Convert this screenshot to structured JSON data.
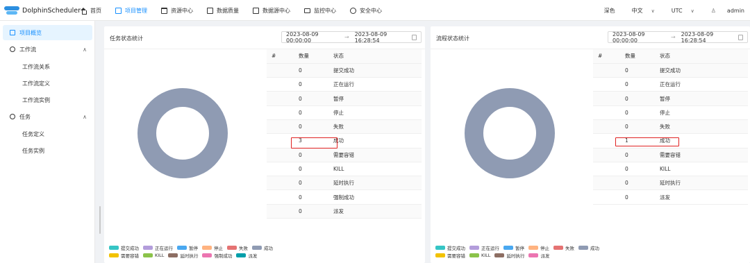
{
  "app": {
    "name": "DolphinScheduler"
  },
  "nav": [
    {
      "label": "首页",
      "icon": "home-icon"
    },
    {
      "label": "项目管理",
      "icon": "project-icon",
      "active": true
    },
    {
      "label": "资源中心",
      "icon": "folder-icon"
    },
    {
      "label": "数据质量",
      "icon": "quality-icon"
    },
    {
      "label": "数据源中心",
      "icon": "datasource-icon"
    },
    {
      "label": "监控中心",
      "icon": "monitor-icon"
    },
    {
      "label": "安全中心",
      "icon": "security-icon"
    }
  ],
  "header_right": {
    "theme": "深色",
    "language": "中文",
    "timezone": "UTC",
    "user": "admin"
  },
  "sidebar": {
    "overview": "项目概览",
    "workflow": "工作流",
    "workflow_items": [
      "工作流关系",
      "工作流定义",
      "工作流实例"
    ],
    "task": "任务",
    "task_items": [
      "任务定义",
      "任务实例"
    ]
  },
  "task_panel": {
    "title": "任务状态统计",
    "date_start": "2023-08-09 00:00:00",
    "date_end": "2023-08-09 16:28:54",
    "columns": [
      "#",
      "数量",
      "状态"
    ],
    "rows": [
      {
        "count": "0",
        "state": "提交成功"
      },
      {
        "count": "0",
        "state": "正在运行"
      },
      {
        "count": "0",
        "state": "暂停"
      },
      {
        "count": "0",
        "state": "停止"
      },
      {
        "count": "0",
        "state": "失败"
      },
      {
        "count": "3",
        "state": "成功"
      },
      {
        "count": "0",
        "state": "需要容错"
      },
      {
        "count": "0",
        "state": "KILL"
      },
      {
        "count": "0",
        "state": "延时执行"
      },
      {
        "count": "0",
        "state": "强制成功"
      },
      {
        "count": "0",
        "state": "派发"
      }
    ],
    "legend_row1": [
      {
        "label": "提交成功",
        "color": "#36c5c5"
      },
      {
        "label": "正在运行",
        "color": "#b39ddb"
      },
      {
        "label": "暂停",
        "color": "#4aa8f0"
      },
      {
        "label": "停止",
        "color": "#ffb380"
      },
      {
        "label": "失败",
        "color": "#e57373"
      },
      {
        "label": "成功",
        "color": "#8f9bb3"
      }
    ],
    "legend_row2": [
      {
        "label": "需要容错",
        "color": "#f2c200"
      },
      {
        "label": "KILL",
        "color": "#8bc34a"
      },
      {
        "label": "延时执行",
        "color": "#8d6e63"
      },
      {
        "label": "强制成功",
        "color": "#ec75b1"
      },
      {
        "label": "派发",
        "color": "#009faa"
      }
    ]
  },
  "process_panel": {
    "title": "流程状态统计",
    "date_start": "2023-08-09 00:00:00",
    "date_end": "2023-08-09 16:28:54",
    "columns": [
      "#",
      "数量",
      "状态"
    ],
    "rows": [
      {
        "count": "0",
        "state": "提交成功"
      },
      {
        "count": "0",
        "state": "正在运行"
      },
      {
        "count": "0",
        "state": "暂停"
      },
      {
        "count": "0",
        "state": "停止"
      },
      {
        "count": "0",
        "state": "失败"
      },
      {
        "count": "1",
        "state": "成功"
      },
      {
        "count": "0",
        "state": "需要容错"
      },
      {
        "count": "0",
        "state": "KILL"
      },
      {
        "count": "0",
        "state": "延时执行"
      },
      {
        "count": "0",
        "state": "派发"
      }
    ],
    "legend_row1": [
      {
        "label": "提交成功",
        "color": "#36c5c5"
      },
      {
        "label": "正在运行",
        "color": "#b39ddb"
      },
      {
        "label": "暂停",
        "color": "#4aa8f0"
      },
      {
        "label": "停止",
        "color": "#ffb380"
      },
      {
        "label": "失败",
        "color": "#e57373"
      },
      {
        "label": "成功",
        "color": "#8f9bb3"
      }
    ],
    "legend_row2": [
      {
        "label": "需要容错",
        "color": "#f2c200"
      },
      {
        "label": "KILL",
        "color": "#8bc34a"
      },
      {
        "label": "延时执行",
        "color": "#8d6e63"
      },
      {
        "label": "派发",
        "color": "#ec75b1"
      }
    ]
  },
  "chart_data": [
    {
      "type": "pie",
      "categories": [
        "提交成功",
        "正在运行",
        "暂停",
        "停止",
        "失败",
        "成功",
        "需要容错",
        "KILL",
        "延时执行",
        "强制成功",
        "派发"
      ],
      "values": [
        0,
        0,
        0,
        0,
        0,
        3,
        0,
        0,
        0,
        0,
        0
      ],
      "title": "任务状态统计",
      "donut": true,
      "legend": "bottom-left"
    },
    {
      "type": "pie",
      "categories": [
        "提交成功",
        "正在运行",
        "暂停",
        "停止",
        "失败",
        "成功",
        "需要容错",
        "KILL",
        "延时执行",
        "派发"
      ],
      "values": [
        0,
        0,
        0,
        0,
        0,
        1,
        0,
        0,
        0,
        0
      ],
      "title": "流程状态统计",
      "donut": true,
      "legend": "bottom-left"
    }
  ]
}
